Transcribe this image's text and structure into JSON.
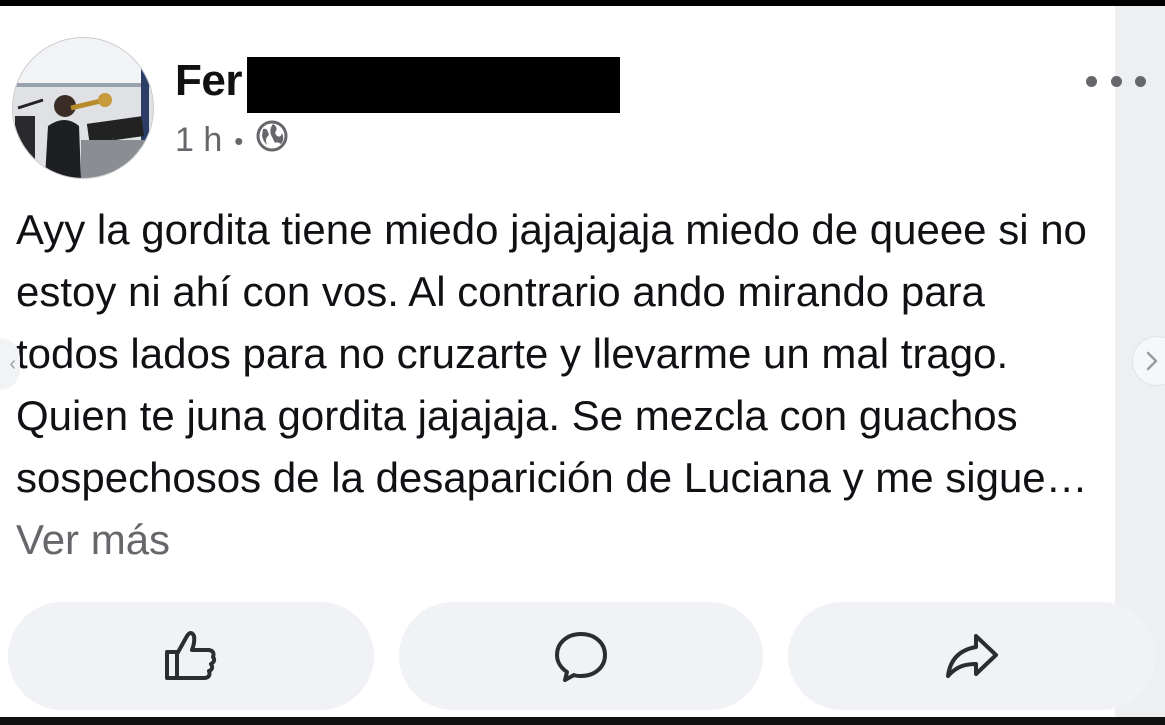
{
  "post": {
    "author_name_visible": "Fer",
    "timestamp": "1 h",
    "separator": "•",
    "privacy_icon": "globe-icon",
    "body_text": "Ayy la gordita tiene miedo jajajajaja miedo de queee si no estoy ni ahí con vos. Al contrario ando mirando para todos lados para no cruzarte y llevarme un mal trago. Quien te juna gordita jajajaja. Se mezcla con guachos sospechosos de la desaparición de Luciana y me sigue…",
    "see_more_label": "Ver más",
    "more_menu_icon": "more-horizontal-icon"
  },
  "actions": [
    {
      "name": "like",
      "icon": "thumbs-up-icon"
    },
    {
      "name": "comment",
      "icon": "comment-bubble-icon"
    },
    {
      "name": "share",
      "icon": "share-arrow-icon"
    }
  ],
  "navigation": {
    "prev_icon": "chevron-left-icon",
    "next_icon": "chevron-right-icon"
  },
  "colors": {
    "text_primary": "#101114",
    "text_secondary": "#65676b",
    "button_background": "#f0f2f5",
    "page_background": "#ffffff"
  }
}
